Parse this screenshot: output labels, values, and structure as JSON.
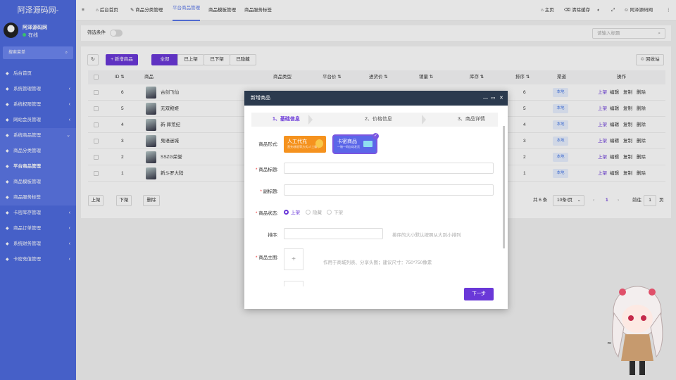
{
  "brand": "阿泽源码网-",
  "user": {
    "name": "阿泽源码网",
    "status": "在线"
  },
  "sidebar": {
    "search_label": "搜索菜单",
    "items": [
      {
        "label": "后台首页",
        "icon": "home-icon",
        "arrow": ""
      },
      {
        "label": "系统管理管理",
        "icon": "gear-icon",
        "arrow": "‹"
      },
      {
        "label": "系统权限管理",
        "icon": "users-icon",
        "arrow": "‹"
      },
      {
        "label": "网站会员管理",
        "icon": "user-icon",
        "arrow": "‹"
      },
      {
        "label": "系统商品管理",
        "icon": "list-icon",
        "arrow": "⌄"
      },
      {
        "label": "商品分类管理",
        "icon": "tag-icon",
        "arrow": ""
      },
      {
        "label": "平台商品管理",
        "icon": "shop-icon",
        "arrow": ""
      },
      {
        "label": "商品模板管理",
        "icon": "template-icon",
        "arrow": ""
      },
      {
        "label": "商品服务标签",
        "icon": "label-icon",
        "arrow": ""
      },
      {
        "label": "卡密库存管理",
        "icon": "key-icon",
        "arrow": "‹"
      },
      {
        "label": "商品订单管理",
        "icon": "order-icon",
        "arrow": "‹"
      },
      {
        "label": "系统财务管理",
        "icon": "finance-icon",
        "arrow": "‹"
      },
      {
        "label": "卡密充值管理",
        "icon": "card-icon",
        "arrow": "‹"
      }
    ]
  },
  "topbar": {
    "menu_icon": "≡",
    "tabs": [
      "后台首页",
      "商品分类管理",
      "平台商品管理",
      "商品模板管理",
      "商品服务标签"
    ],
    "right": [
      "主页",
      "清除缓存",
      "阿泽源码网"
    ]
  },
  "filter": {
    "label": "筛选条件",
    "search_placeholder": "请输入标题"
  },
  "toolbar": {
    "add_label": "+ 新增商品",
    "status_tabs": [
      "全部",
      "已上架",
      "已下架",
      "已隐藏"
    ],
    "recycle_label": "回收站"
  },
  "table": {
    "headers": [
      "ID",
      "商品",
      "商品类型",
      "平台价",
      "进货价",
      "销量",
      "库存",
      "排序",
      "渠道",
      "操作"
    ],
    "rows": [
      {
        "id": "6",
        "name": "古剑飞仙",
        "sort": "6",
        "channel": "本地"
      },
      {
        "id": "5",
        "name": "无双殿姬",
        "sort": "5",
        "channel": "本地"
      },
      {
        "id": "4",
        "name": "新·葬荒纪",
        "sort": "4",
        "channel": "本地"
      },
      {
        "id": "3",
        "name": "鬼语迷城",
        "sort": "3",
        "channel": "本地"
      },
      {
        "id": "2",
        "name": "SSZG荣誉",
        "sort": "2",
        "channel": "本地"
      },
      {
        "id": "1",
        "name": "新斗罗大陆",
        "sort": "1",
        "channel": "本地"
      }
    ],
    "actions": [
      "上架",
      "编辑",
      "复制",
      "删除"
    ]
  },
  "bulk": [
    "上架",
    "下架",
    "删除"
  ],
  "pagination": {
    "total": "共 6 条",
    "page_size": "10条/页",
    "prev": "‹",
    "current": "1",
    "next": "›",
    "goto_label": "前往",
    "goto_value": "1",
    "goto_suffix": "页"
  },
  "modal": {
    "title": "新增商品",
    "steps": [
      "1、基础信息",
      "2、价格信息",
      "3、商品详情"
    ],
    "form_label": "商品形式:",
    "form_types": [
      {
        "title": "人工代充",
        "sub": "直充/核验等方式/人工操作",
        "color": "#f5921e"
      },
      {
        "title": "卡密商品",
        "sub": "一物一码自动发货",
        "color": "#5b66e8"
      }
    ],
    "fields": {
      "title_label": "商品标题:",
      "subtitle_label": "副标题:",
      "status_label": "商品状态:",
      "status_options": [
        "上架",
        "隐藏",
        "下架"
      ],
      "sort_label": "排序:",
      "sort_hint": "排序的大小默认按照从大到小排列",
      "image_label": "商品主图:",
      "image_hint": "作用于商城列表、分享头图；建议尺寸：750*750像素",
      "image_plus": "+"
    },
    "next_label": "下一步"
  }
}
